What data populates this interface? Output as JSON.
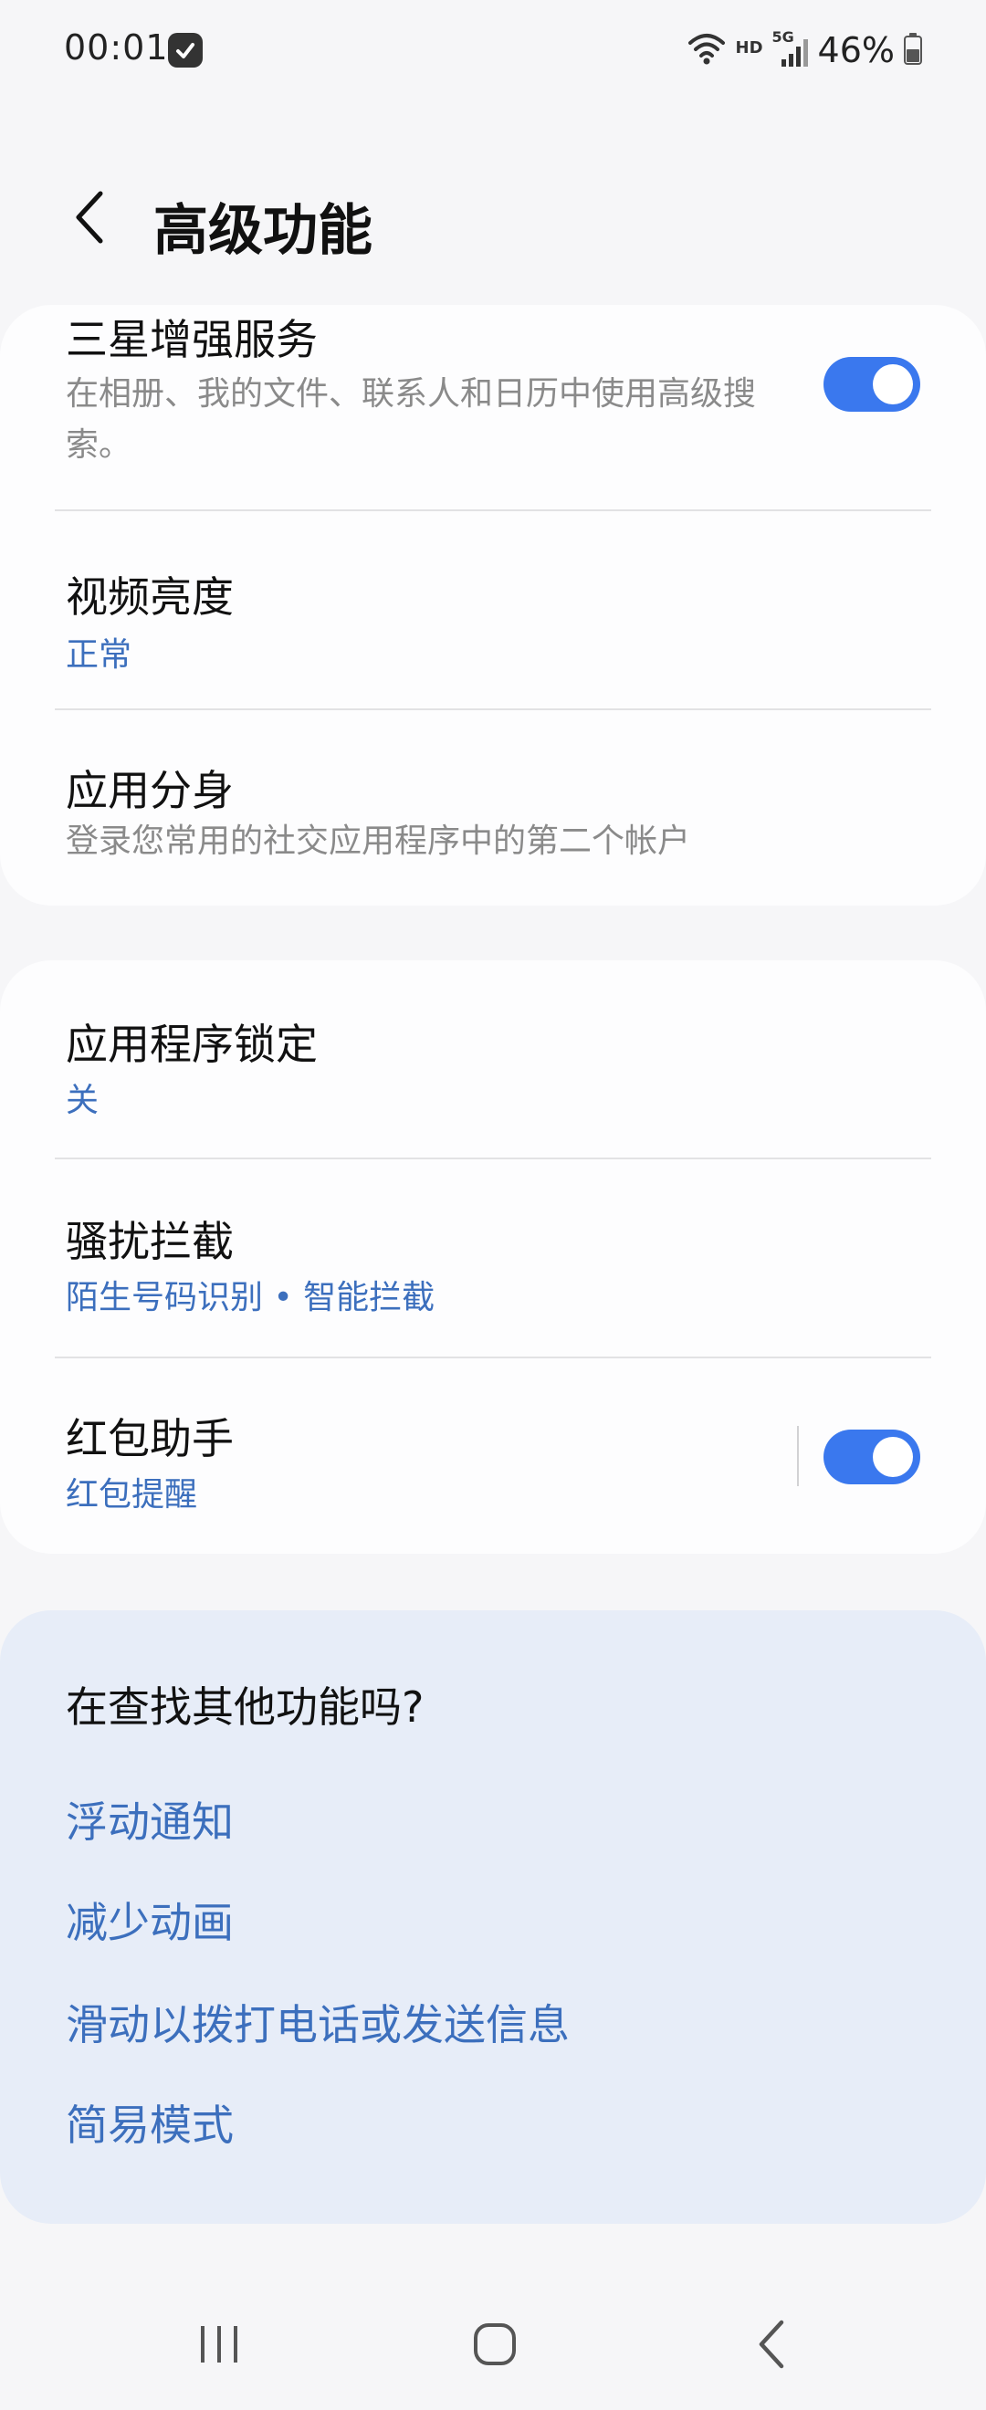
{
  "status_bar": {
    "time": "00:01",
    "network_hd": "HD",
    "network_type": "5G",
    "battery_percent": "46%"
  },
  "header": {
    "title": "高级功能"
  },
  "card1": {
    "items": [
      {
        "title": "三星增强服务",
        "subtitle": "在相册、我的文件、联系人和日历中使用高级搜索。",
        "toggle_on": true
      },
      {
        "title": "视频亮度",
        "value": "正常"
      },
      {
        "title": "应用分身",
        "subtitle": "登录您常用的社交应用程序中的第二个帐户"
      }
    ]
  },
  "card2": {
    "items": [
      {
        "title": "应用程序锁定",
        "value": "关"
      },
      {
        "title": "骚扰拦截",
        "value": "陌生号码识别 • 智能拦截"
      },
      {
        "title": "红包助手",
        "value": "红包提醒",
        "toggle_on": true
      }
    ]
  },
  "suggestions": {
    "heading": "在查找其他功能吗?",
    "links": [
      "浮动通知",
      "减少动画",
      "滑动以拨打电话或发送信息",
      "简易模式"
    ]
  },
  "colors": {
    "accent": "#3a78ee",
    "link": "#3c6fbd",
    "background": "#f6f6f8",
    "card": "#fdfdfe",
    "suggest_card": "#e7edf8"
  },
  "icons": {
    "back": "chevron-left-icon",
    "recents": "recents-icon",
    "home": "home-icon",
    "nav_back": "nav-back-icon"
  }
}
